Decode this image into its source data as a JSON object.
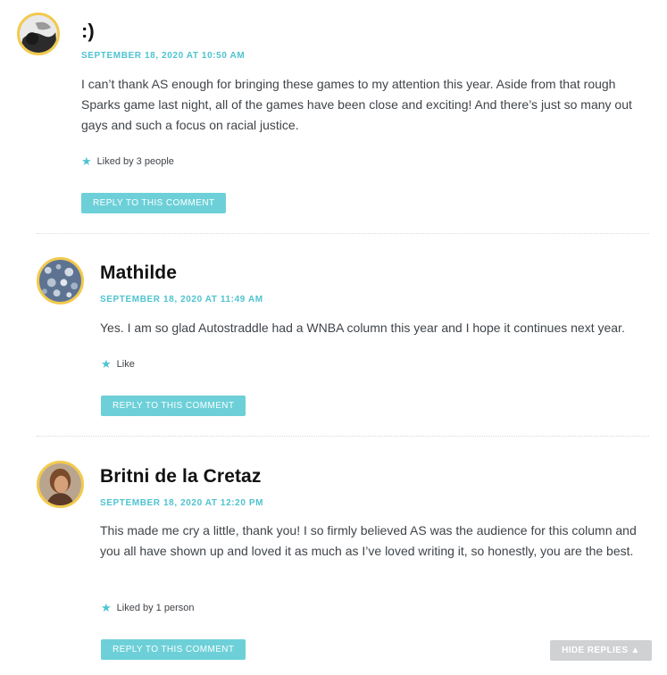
{
  "comments": [
    {
      "author": ":)",
      "date": "SEPTEMBER 18, 2020 AT 10:50 AM",
      "text": "I can’t thank AS enough for bringing these games to my attention this year. Aside from that rough Sparks game last night, all of the games have been close and exciting! And there’s just so many out gays and such a focus on racial justice.",
      "likes": "Liked by 3 people",
      "reply_label": "REPLY TO THIS COMMENT",
      "avatar_icon": "user-photo-icon"
    },
    {
      "author": "Mathilde",
      "date": "SEPTEMBER 18, 2020 AT 11:49 AM",
      "text": "Yes. I am so glad Autostraddle had a WNBA column this year and I hope it continues next year.",
      "likes": "Like",
      "reply_label": "REPLY TO THIS COMMENT",
      "avatar_icon": "user-photo-icon"
    },
    {
      "author": "Britni de la Cretaz",
      "date": "SEPTEMBER 18, 2020 AT 12:20 PM",
      "text": "This made me cry a little, thank you! I so firmly believed AS was the audience for this column and you all have shown up and loved it as much as I’ve loved writing it, so honestly, you are the best.",
      "likes": "Liked by 1 person",
      "reply_label": "REPLY TO THIS COMMENT",
      "avatar_icon": "user-photo-icon"
    }
  ],
  "hide_replies_label": "HIDE REPLIES ▲",
  "colors": {
    "accent": "#4ec3cf",
    "button": "#6dd0d8",
    "avatar_ring": "#f2c94c",
    "hide_button": "#cfd1d3"
  }
}
